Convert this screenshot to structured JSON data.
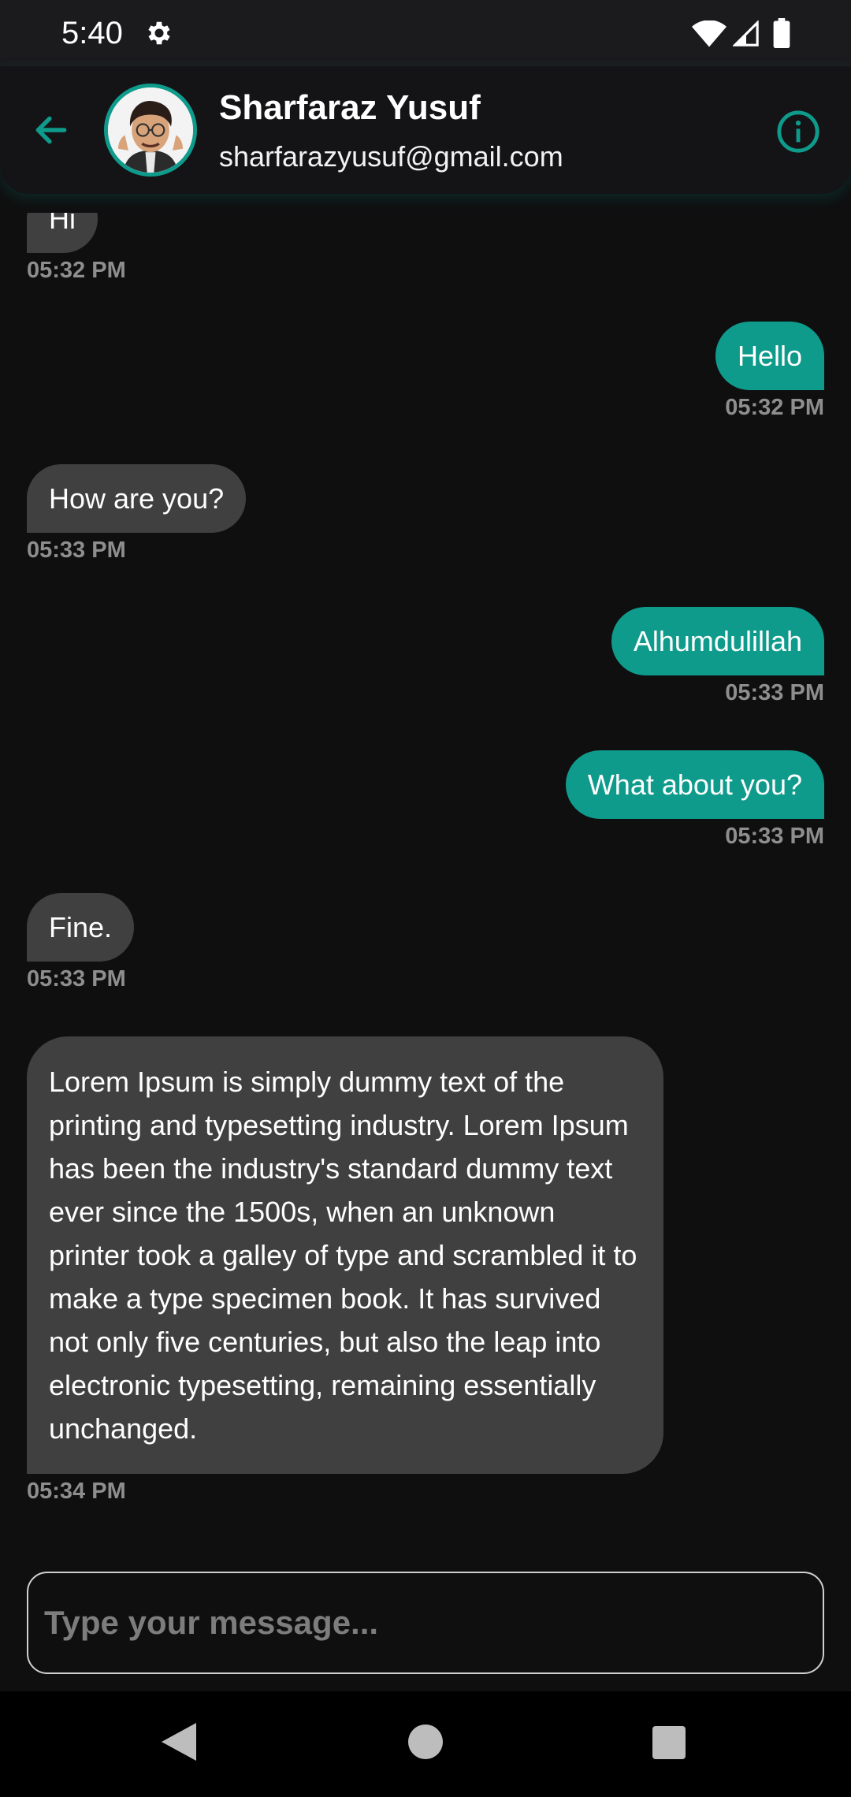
{
  "status_bar": {
    "time": "5:40"
  },
  "header": {
    "name": "Sharfaraz Yusuf",
    "email": "sharfarazyusuf@gmail.com"
  },
  "messages": [
    {
      "direction": "received",
      "text": "Hi",
      "time": "05:32 PM"
    },
    {
      "direction": "sent",
      "text": "Hello",
      "time": "05:32 PM"
    },
    {
      "direction": "received",
      "text": "How are you?",
      "time": "05:33 PM"
    },
    {
      "direction": "sent",
      "text": "Alhumdulillah",
      "time": "05:33 PM"
    },
    {
      "direction": "sent",
      "text": "What about you?",
      "time": "05:33 PM"
    },
    {
      "direction": "received",
      "text": "Fine.",
      "time": "05:33 PM"
    },
    {
      "direction": "received",
      "text": "Lorem Ipsum is simply dummy text of the printing and typesetting industry. Lorem Ipsum has been the industry's standard dummy text ever since the 1500s, when an unknown printer took a galley of type and scrambled it to make a type specimen book. It has survived not only five centuries, but also the leap into electronic typesetting, remaining essentially unchanged.",
      "time": "05:34 PM"
    }
  ],
  "composer": {
    "placeholder": "Type your message..."
  },
  "colors": {
    "accent": "#0f9b8c",
    "received_bubble": "#404040",
    "background": "#0f0f10"
  }
}
